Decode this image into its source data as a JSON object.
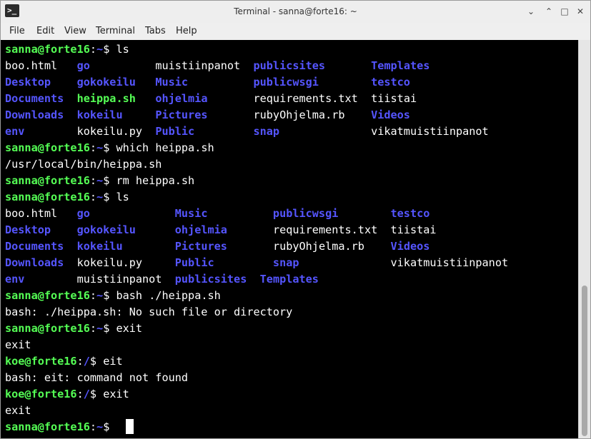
{
  "window": {
    "title": "Terminal - sanna@forte16: ~",
    "icon": "terminal-icon",
    "controls": {
      "minimize": "⌄",
      "restore": "⌃",
      "maximize": "□",
      "close": "✕"
    }
  },
  "menu": [
    "File",
    "Edit",
    "View",
    "Terminal",
    "Tabs",
    "Help"
  ],
  "colors": {
    "background": "#000000",
    "text": "#ffffff",
    "prompt_green": "#55ff55",
    "directory_blue": "#5555ff"
  },
  "lines": [
    [
      [
        "sanna@forte16",
        "g"
      ],
      [
        ":",
        "w"
      ],
      [
        "~",
        "b"
      ],
      [
        "$ ls",
        "w"
      ]
    ],
    [
      [
        "boo.html   ",
        "w"
      ],
      [
        "go",
        "b"
      ],
      [
        "          ",
        "w"
      ],
      [
        "muistiinpanot",
        "w"
      ],
      [
        "  ",
        "w"
      ],
      [
        "publicsites",
        "b"
      ],
      [
        "       ",
        "w"
      ],
      [
        "Templates",
        "b"
      ]
    ],
    [
      [
        "Desktop",
        "b"
      ],
      [
        "    ",
        "w"
      ],
      [
        "gokokeilu",
        "b"
      ],
      [
        "   ",
        "w"
      ],
      [
        "Music",
        "b"
      ],
      [
        "          ",
        "w"
      ],
      [
        "publicwsgi",
        "b"
      ],
      [
        "        ",
        "w"
      ],
      [
        "testco",
        "b"
      ]
    ],
    [
      [
        "Documents",
        "b"
      ],
      [
        "  ",
        "w"
      ],
      [
        "heippa.sh",
        "g"
      ],
      [
        "   ",
        "w"
      ],
      [
        "ohjelmia",
        "b"
      ],
      [
        "       ",
        "w"
      ],
      [
        "requirements.txt",
        "w"
      ],
      [
        "  ",
        "w"
      ],
      [
        "tiistai",
        "w"
      ]
    ],
    [
      [
        "Downloads",
        "b"
      ],
      [
        "  ",
        "w"
      ],
      [
        "kokeilu",
        "b"
      ],
      [
        "     ",
        "w"
      ],
      [
        "Pictures",
        "b"
      ],
      [
        "       ",
        "w"
      ],
      [
        "rubyOhjelma.rb",
        "w"
      ],
      [
        "    ",
        "w"
      ],
      [
        "Videos",
        "b"
      ]
    ],
    [
      [
        "env",
        "b"
      ],
      [
        "        ",
        "w"
      ],
      [
        "kokeilu.py",
        "w"
      ],
      [
        "  ",
        "w"
      ],
      [
        "Public",
        "b"
      ],
      [
        "         ",
        "w"
      ],
      [
        "snap",
        "b"
      ],
      [
        "              ",
        "w"
      ],
      [
        "vikatmuistiinpanot",
        "w"
      ]
    ],
    [
      [
        "sanna@forte16",
        "g"
      ],
      [
        ":",
        "w"
      ],
      [
        "~",
        "b"
      ],
      [
        "$ which heippa.sh",
        "w"
      ]
    ],
    [
      [
        "/usr/local/bin/heippa.sh",
        "w"
      ]
    ],
    [
      [
        "sanna@forte16",
        "g"
      ],
      [
        ":",
        "w"
      ],
      [
        "~",
        "b"
      ],
      [
        "$ rm heippa.sh",
        "w"
      ]
    ],
    [
      [
        "sanna@forte16",
        "g"
      ],
      [
        ":",
        "w"
      ],
      [
        "~",
        "b"
      ],
      [
        "$ ls",
        "w"
      ]
    ],
    [
      [
        "boo.html   ",
        "w"
      ],
      [
        "go",
        "b"
      ],
      [
        "             ",
        "w"
      ],
      [
        "Music",
        "b"
      ],
      [
        "          ",
        "w"
      ],
      [
        "publicwsgi",
        "b"
      ],
      [
        "        ",
        "w"
      ],
      [
        "testco",
        "b"
      ]
    ],
    [
      [
        "Desktop",
        "b"
      ],
      [
        "    ",
        "w"
      ],
      [
        "gokokeilu",
        "b"
      ],
      [
        "      ",
        "w"
      ],
      [
        "ohjelmia",
        "b"
      ],
      [
        "       ",
        "w"
      ],
      [
        "requirements.txt",
        "w"
      ],
      [
        "  ",
        "w"
      ],
      [
        "tiistai",
        "w"
      ]
    ],
    [
      [
        "Documents",
        "b"
      ],
      [
        "  ",
        "w"
      ],
      [
        "kokeilu",
        "b"
      ],
      [
        "        ",
        "w"
      ],
      [
        "Pictures",
        "b"
      ],
      [
        "       ",
        "w"
      ],
      [
        "rubyOhjelma.rb",
        "w"
      ],
      [
        "    ",
        "w"
      ],
      [
        "Videos",
        "b"
      ]
    ],
    [
      [
        "Downloads",
        "b"
      ],
      [
        "  ",
        "w"
      ],
      [
        "kokeilu.py",
        "w"
      ],
      [
        "     ",
        "w"
      ],
      [
        "Public",
        "b"
      ],
      [
        "         ",
        "w"
      ],
      [
        "snap",
        "b"
      ],
      [
        "              ",
        "w"
      ],
      [
        "vikatmuistiinpanot",
        "w"
      ]
    ],
    [
      [
        "env",
        "b"
      ],
      [
        "        ",
        "w"
      ],
      [
        "muistiinpanot",
        "w"
      ],
      [
        "  ",
        "w"
      ],
      [
        "publicsites",
        "b"
      ],
      [
        "  ",
        "w"
      ],
      [
        "Templates",
        "b"
      ]
    ],
    [
      [
        "sanna@forte16",
        "g"
      ],
      [
        ":",
        "w"
      ],
      [
        "~",
        "b"
      ],
      [
        "$ bash ./heippa.sh",
        "w"
      ]
    ],
    [
      [
        "bash: ./heippa.sh: No such file or directory",
        "w"
      ]
    ],
    [
      [
        "sanna@forte16",
        "g"
      ],
      [
        ":",
        "w"
      ],
      [
        "~",
        "b"
      ],
      [
        "$ exit",
        "w"
      ]
    ],
    [
      [
        "exit",
        "w"
      ]
    ],
    [
      [
        "koe@forte16",
        "g"
      ],
      [
        ":",
        "w"
      ],
      [
        "/",
        "b"
      ],
      [
        "$ eit",
        "w"
      ]
    ],
    [
      [
        "bash: eit: command not found",
        "w"
      ]
    ],
    [
      [
        "koe@forte16",
        "g"
      ],
      [
        ":",
        "w"
      ],
      [
        "/",
        "b"
      ],
      [
        "$ exit",
        "w"
      ]
    ],
    [
      [
        "exit",
        "w"
      ]
    ],
    [
      [
        "sanna@forte16",
        "g"
      ],
      [
        ":",
        "w"
      ],
      [
        "~",
        "b"
      ],
      [
        "$ ",
        "w"
      ]
    ]
  ]
}
